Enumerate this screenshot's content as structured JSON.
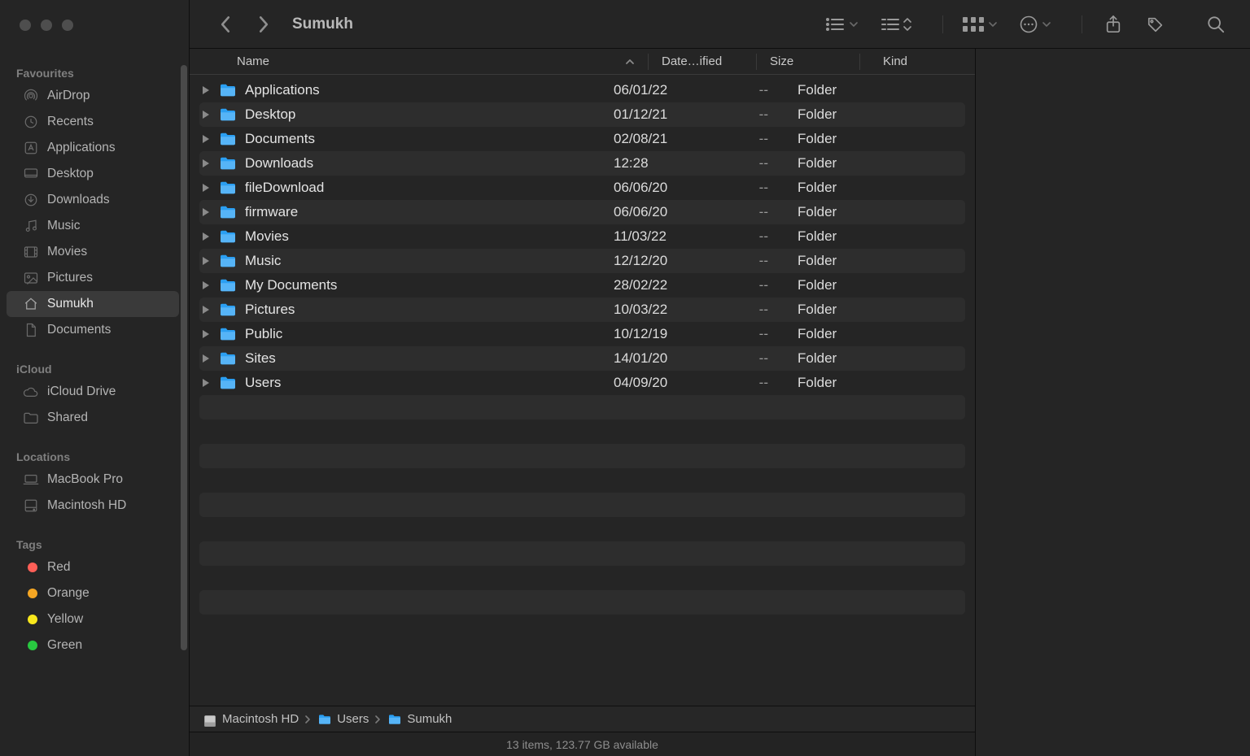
{
  "window_title": "Sumukh",
  "sidebar": {
    "sections": [
      {
        "header": "Favourites",
        "items": [
          {
            "label": "AirDrop",
            "icon": "airdrop-icon",
            "selected": false
          },
          {
            "label": "Recents",
            "icon": "clock-icon",
            "selected": false
          },
          {
            "label": "Applications",
            "icon": "applications-icon",
            "selected": false
          },
          {
            "label": "Desktop",
            "icon": "desktop-icon",
            "selected": false
          },
          {
            "label": "Downloads",
            "icon": "downloads-icon",
            "selected": false
          },
          {
            "label": "Music",
            "icon": "music-icon",
            "selected": false
          },
          {
            "label": "Movies",
            "icon": "movies-icon",
            "selected": false
          },
          {
            "label": "Pictures",
            "icon": "pictures-icon",
            "selected": false
          },
          {
            "label": "Sumukh",
            "icon": "home-icon",
            "selected": true
          },
          {
            "label": "Documents",
            "icon": "documents-icon",
            "selected": false
          }
        ]
      },
      {
        "header": "iCloud",
        "items": [
          {
            "label": "iCloud Drive",
            "icon": "cloud-icon",
            "selected": false
          },
          {
            "label": "Shared",
            "icon": "shared-folder-icon",
            "selected": false
          }
        ]
      },
      {
        "header": "Locations",
        "items": [
          {
            "label": "MacBook Pro",
            "icon": "laptop-icon",
            "selected": false
          },
          {
            "label": "Macintosh HD",
            "icon": "disk-icon",
            "selected": false
          }
        ]
      },
      {
        "header": "Tags",
        "items": [
          {
            "label": "Red",
            "icon": "tag-dot",
            "color": "#ff5f57"
          },
          {
            "label": "Orange",
            "icon": "tag-dot",
            "color": "#f5a623"
          },
          {
            "label": "Yellow",
            "icon": "tag-dot",
            "color": "#f8e71c"
          },
          {
            "label": "Green",
            "icon": "tag-dot",
            "color": "#28c840"
          }
        ]
      }
    ]
  },
  "columns": {
    "name": "Name",
    "date": "Date…ified",
    "size": "Size",
    "kind": "Kind"
  },
  "files": [
    {
      "name": "Applications",
      "date": "06/01/22",
      "size": "--",
      "kind": "Folder"
    },
    {
      "name": "Desktop",
      "date": "01/12/21",
      "size": "--",
      "kind": "Folder"
    },
    {
      "name": "Documents",
      "date": "02/08/21",
      "size": "--",
      "kind": "Folder"
    },
    {
      "name": "Downloads",
      "date": "12:28",
      "size": "--",
      "kind": "Folder"
    },
    {
      "name": "fileDownload",
      "date": "06/06/20",
      "size": "--",
      "kind": "Folder"
    },
    {
      "name": "firmware",
      "date": "06/06/20",
      "size": "--",
      "kind": "Folder"
    },
    {
      "name": "Movies",
      "date": "11/03/22",
      "size": "--",
      "kind": "Folder"
    },
    {
      "name": "Music",
      "date": "12/12/20",
      "size": "--",
      "kind": "Folder"
    },
    {
      "name": "My Documents",
      "date": "28/02/22",
      "size": "--",
      "kind": "Folder"
    },
    {
      "name": "Pictures",
      "date": "10/03/22",
      "size": "--",
      "kind": "Folder"
    },
    {
      "name": "Public",
      "date": "10/12/19",
      "size": "--",
      "kind": "Folder"
    },
    {
      "name": "Sites",
      "date": "14/01/20",
      "size": "--",
      "kind": "Folder"
    },
    {
      "name": "Users",
      "date": "04/09/20",
      "size": "--",
      "kind": "Folder"
    }
  ],
  "pathbar": [
    {
      "label": "Macintosh HD",
      "icon": "disk"
    },
    {
      "label": "Users",
      "icon": "folder"
    },
    {
      "label": "Sumukh",
      "icon": "folder"
    }
  ],
  "statusbar": "13 items, 123.77 GB available",
  "extra_rows": 10
}
